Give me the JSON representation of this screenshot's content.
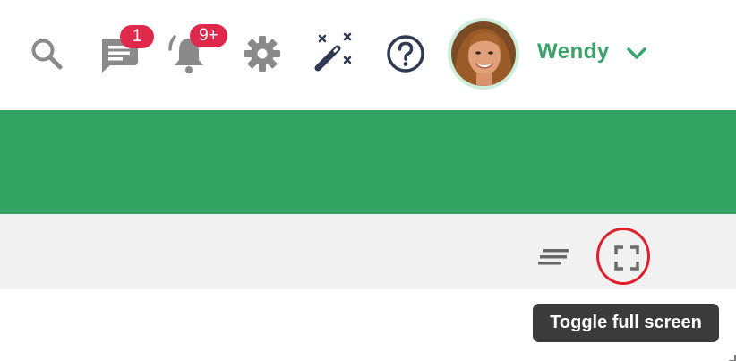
{
  "header": {
    "icons": [
      {
        "name": "search-icon"
      },
      {
        "name": "messages-icon",
        "badge": "1"
      },
      {
        "name": "notifications-icon",
        "badge": "9+"
      },
      {
        "name": "settings-icon"
      },
      {
        "name": "magic-wand-icon"
      },
      {
        "name": "help-icon"
      }
    ],
    "user": {
      "name": "Wendy"
    }
  },
  "toolbar": {
    "icons": [
      {
        "name": "text-align-icon"
      },
      {
        "name": "fullscreen-icon"
      }
    ]
  },
  "tooltip": {
    "text": "Toggle full screen"
  },
  "colors": {
    "brand_green": "#33a364",
    "username_green": "#3aa36a",
    "badge_red": "#e0284b",
    "highlight_red": "#e0202a",
    "toolbar_gray": "#f1f1f1",
    "tooltip_bg": "#3b3b3b",
    "icon_gray": "#8a8a8a",
    "icon_navy": "#2f3b52"
  }
}
